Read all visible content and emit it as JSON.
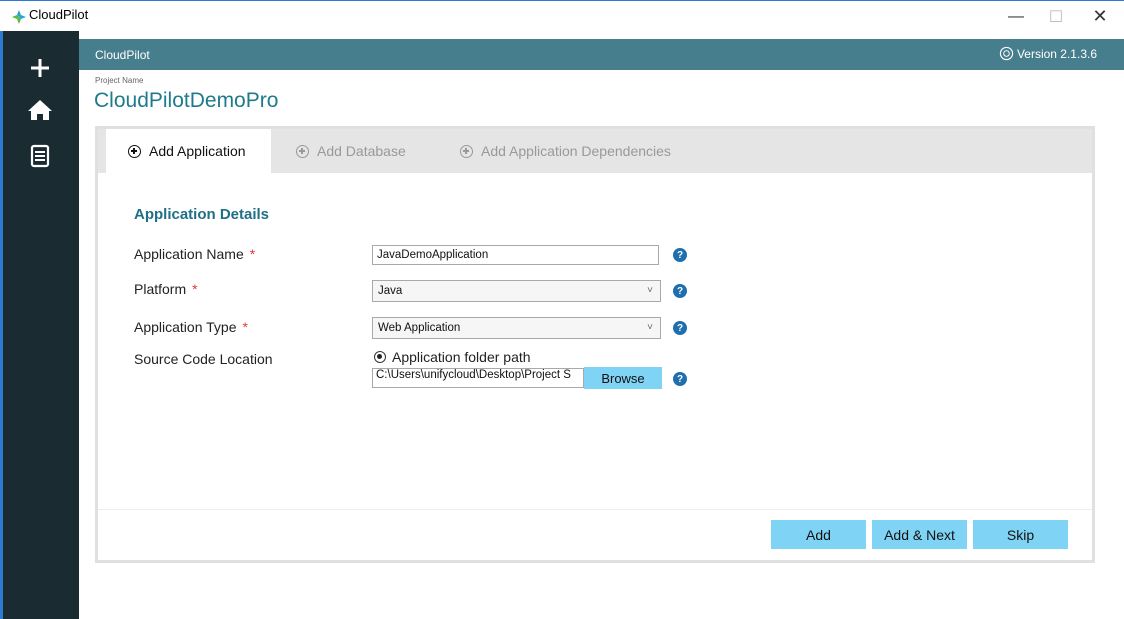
{
  "window": {
    "title": "CloudPilot",
    "icon": "cloudpilot-logo-icon",
    "controls": {
      "minimize": "—",
      "maximize": "☐",
      "close": "✕"
    }
  },
  "sidebar": {
    "items": [
      {
        "name": "add-icon",
        "glyph": "+"
      },
      {
        "name": "home-icon",
        "glyph": "⌂"
      },
      {
        "name": "report-icon",
        "glyph": "document"
      }
    ]
  },
  "header": {
    "app_name": "CloudPilot",
    "version": "Version 2.1.3.6",
    "accent": "#477e8d"
  },
  "project": {
    "label": "Project Name",
    "name": "CloudPilotDemoPro"
  },
  "tabs": [
    {
      "label": "Add Application",
      "active": true
    },
    {
      "label": "Add Database",
      "active": false
    },
    {
      "label": "Add Application Dependencies",
      "active": false
    }
  ],
  "form": {
    "section_title": "Application Details",
    "app_name": {
      "label": "Application Name",
      "required": "*",
      "value": "JavaDemoApplication"
    },
    "platform": {
      "label": "Platform",
      "required": "*",
      "value": "Java"
    },
    "app_type": {
      "label": "Application Type",
      "required": "*",
      "value": "Web Application"
    },
    "source": {
      "label": "Source Code Location",
      "radio_label": "Application folder path",
      "path_value": "C:\\Users\\unifycloud\\Desktop\\Project S",
      "browse_label": "Browse"
    },
    "help_glyph": "?"
  },
  "actions": {
    "add": "Add",
    "add_next": "Add & Next",
    "skip": "Skip",
    "button_color": "#7fd4f5"
  }
}
